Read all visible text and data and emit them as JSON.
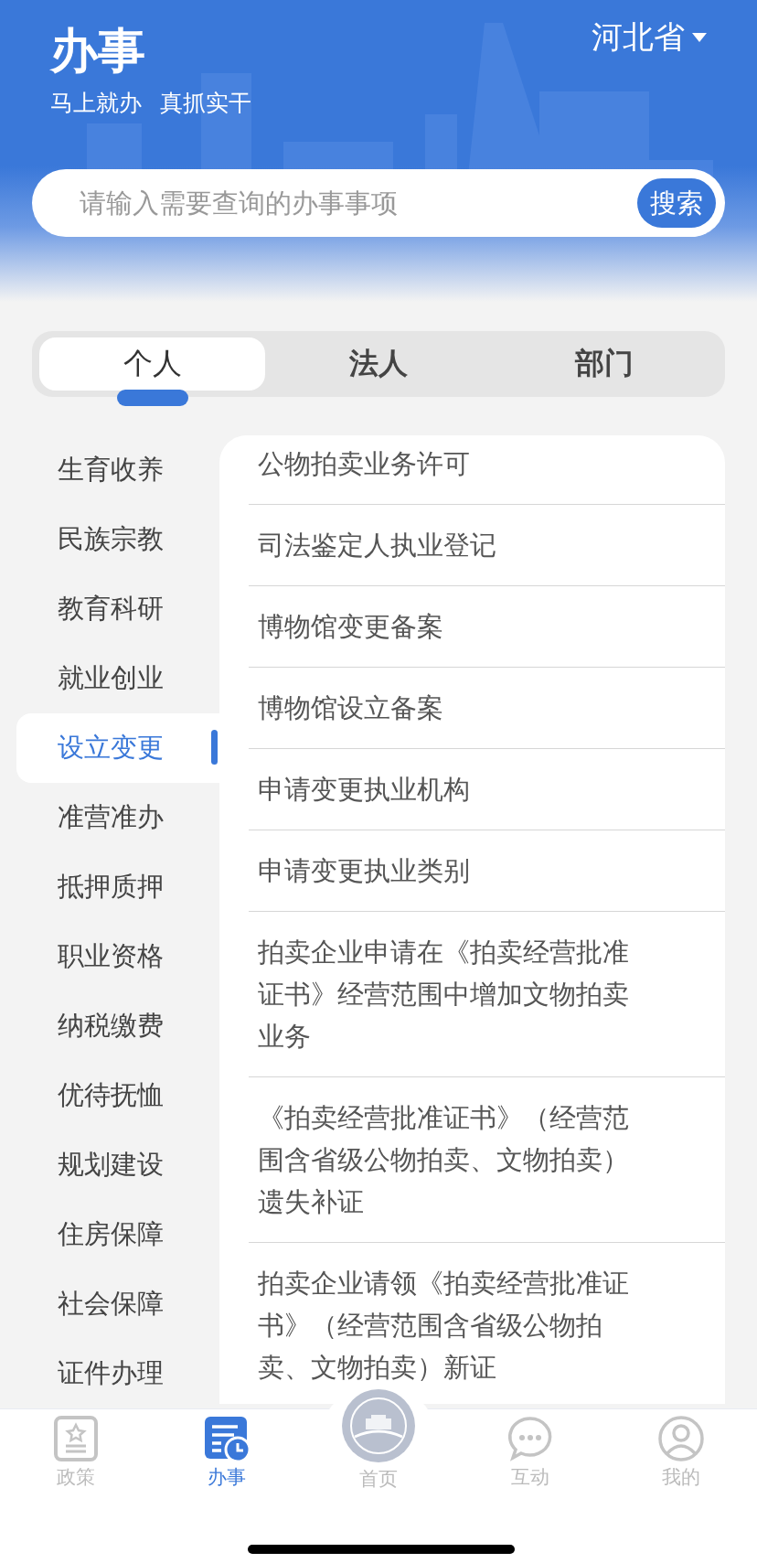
{
  "header": {
    "title": "办事",
    "slogans": [
      "马上就办",
      "真抓实干"
    ],
    "region": "河北省"
  },
  "search": {
    "placeholder": "请输入需要查询的办事事项",
    "button": "搜索"
  },
  "tabs": [
    {
      "label": "个人",
      "selected": true
    },
    {
      "label": "法人",
      "selected": false
    },
    {
      "label": "部门",
      "selected": false
    }
  ],
  "categories": [
    {
      "label": "生育收养",
      "selected": false
    },
    {
      "label": "民族宗教",
      "selected": false
    },
    {
      "label": "教育科研",
      "selected": false
    },
    {
      "label": "就业创业",
      "selected": false
    },
    {
      "label": "设立变更",
      "selected": true
    },
    {
      "label": "准营准办",
      "selected": false
    },
    {
      "label": "抵押质押",
      "selected": false
    },
    {
      "label": "职业资格",
      "selected": false
    },
    {
      "label": "纳税缴费",
      "selected": false
    },
    {
      "label": "优待抚恤",
      "selected": false
    },
    {
      "label": "规划建设",
      "selected": false
    },
    {
      "label": "住房保障",
      "selected": false
    },
    {
      "label": "社会保障",
      "selected": false
    },
    {
      "label": "证件办理",
      "selected": false
    }
  ],
  "services": [
    "公物拍卖业务许可",
    "司法鉴定人执业登记",
    "博物馆变更备案",
    "博物馆设立备案",
    "申请变更执业机构",
    "申请变更执业类别",
    "拍卖企业申请在《拍卖经营批准证书》经营范围中增加文物拍卖业务",
    "《拍卖经营批准证书》（经营范围含省级公物拍卖、文物拍卖）遗失补证",
    "拍卖企业请领《拍卖经营批准证书》（经营范围含省级公物拍卖、文物拍卖）新证"
  ],
  "nav": [
    {
      "label": "政策",
      "kind": "policy",
      "selected": false
    },
    {
      "label": "办事",
      "kind": "affairs",
      "selected": true
    },
    {
      "label": "首页",
      "kind": "home",
      "selected": false
    },
    {
      "label": "互动",
      "kind": "chat",
      "selected": false
    },
    {
      "label": "我的",
      "kind": "profile",
      "selected": false
    }
  ]
}
